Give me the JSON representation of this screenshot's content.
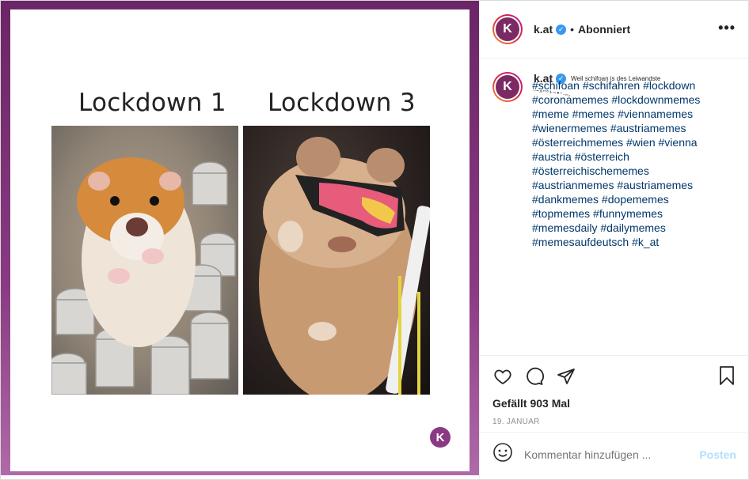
{
  "post": {
    "media": {
      "label_left": "Lockdown 1",
      "label_right": "Lockdown 3",
      "watermark": "K"
    },
    "header": {
      "avatar_letter": "K",
      "username": "k.at",
      "separator": "•",
      "follow_label": "Abonniert",
      "more": "•••"
    },
    "caption": {
      "username": "k.at",
      "text_line1": "Weil schifoan is des Leiwandste",
      "text_line2": "¨˜^\"°¹~•-.„¸",
      "hashtags": [
        "#schifoan #schifahren #lockdown",
        "#coronamemes #lockdownmemes",
        "#meme #memes #viennamemes",
        "#wienermemes #austriamemes",
        "#österreichmemes #wien #vienna",
        "#austria #österreich",
        "#österreichischememes",
        "#austrianmemes #austriamemes",
        "#dankmemes #dopememes",
        "#topmemes #funnymemes",
        "#memesdaily #dailymemes",
        "#memesaufdeutsch #k_at"
      ]
    },
    "actions": {
      "icons": [
        "heart-icon",
        "comment-icon",
        "share-icon",
        "bookmark-icon"
      ],
      "likes": "Gefällt 903 Mal",
      "date": "19. JANUAR"
    },
    "comment": {
      "placeholder": "Kommentar hinzufügen ...",
      "post_label": "Posten"
    },
    "colors": {
      "frame": "#8a3a82",
      "link": "#00376b",
      "verified": "#3897f0",
      "post_disabled": "#b2dffc"
    }
  }
}
